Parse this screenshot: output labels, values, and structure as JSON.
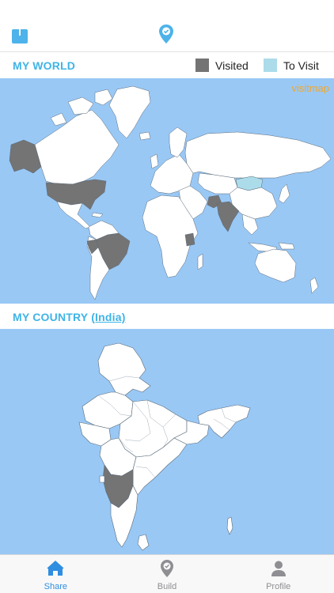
{
  "header": {
    "share_icon": "share-upload-icon",
    "center_icon": "location-pin-check-icon"
  },
  "world": {
    "title": "MY WORLD",
    "legend": [
      {
        "label": "Visited",
        "color": "#747474"
      },
      {
        "label": "To Visit",
        "color": "#acdcea"
      }
    ],
    "watermark": "visitmap"
  },
  "country": {
    "title_prefix": "MY COUNTRY ",
    "country_link": "(India)"
  },
  "colors": {
    "accent": "#3fb4e6",
    "ocean": "#99c8f5",
    "land": "#ffffff",
    "visited": "#747474",
    "to_visit": "#acdcea",
    "tab_active": "#2f8ee0",
    "tab_inactive": "#8e8e93"
  },
  "tabs": [
    {
      "label": "Share",
      "icon": "home-icon",
      "active": true
    },
    {
      "label": "Build",
      "icon": "location-pin-icon",
      "active": false
    },
    {
      "label": "Profile",
      "icon": "person-icon",
      "active": false
    }
  ]
}
